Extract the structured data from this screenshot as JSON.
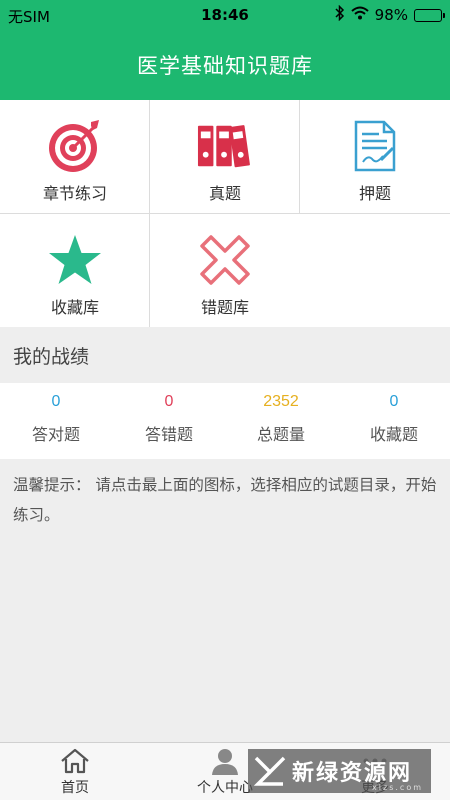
{
  "status_bar": {
    "carrier": "无SIM",
    "time": "18:46",
    "battery": "98%"
  },
  "header": {
    "title": "医学基础知识题库"
  },
  "menu": [
    {
      "label": "章节练习",
      "icon": "target-icon"
    },
    {
      "label": "真题",
      "icon": "binders-icon"
    },
    {
      "label": "押题",
      "icon": "document-pen-icon"
    },
    {
      "label": "收藏库",
      "icon": "star-icon"
    },
    {
      "label": "错题库",
      "icon": "cross-icon"
    }
  ],
  "record": {
    "title": "我的战绩",
    "stats": [
      {
        "value": "0",
        "label": "答对题",
        "color": "#2aa0d8"
      },
      {
        "value": "0",
        "label": "答错题",
        "color": "#e0405a"
      },
      {
        "value": "2352",
        "label": "总题量",
        "color": "#e6b020"
      },
      {
        "value": "0",
        "label": "收藏题",
        "color": "#2aa0d8"
      }
    ]
  },
  "tip": {
    "text": "温馨提示： 请点击最上面的图标，选择相应的试题目录，开始练习。"
  },
  "tabs": [
    {
      "label": "首页",
      "icon": "home-icon"
    },
    {
      "label": "个人中心",
      "icon": "person-icon"
    },
    {
      "label": "更多",
      "icon": "more-icon"
    }
  ],
  "watermark": {
    "text": "新绿资源网",
    "url": "xlzs.com"
  },
  "colors": {
    "primary": "#1db870",
    "red": "#e0405a",
    "teal": "#2ab98c",
    "blue": "#2aa0d8",
    "yellow": "#e6b020"
  }
}
